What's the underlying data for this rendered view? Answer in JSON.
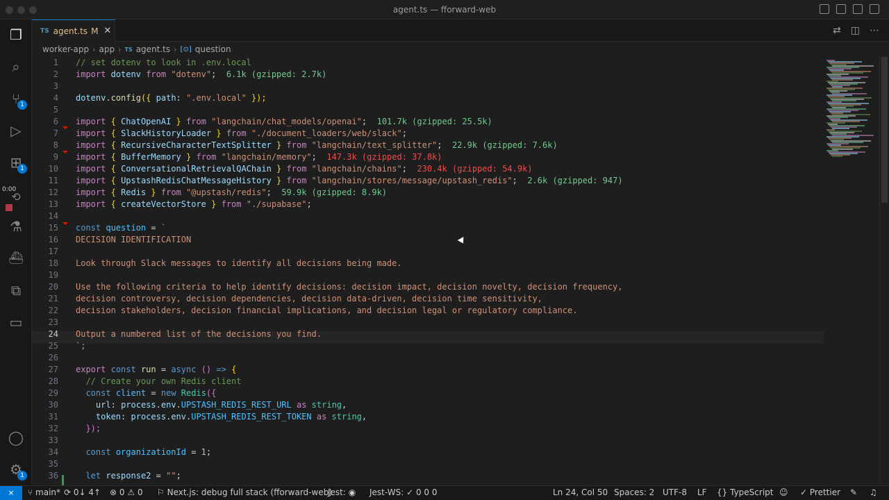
{
  "window": {
    "title": "agent.ts — fforward-web"
  },
  "tab": {
    "type": "TS",
    "name": "agent.ts",
    "modified": "M",
    "close": "✕"
  },
  "breadcrumb": {
    "folder1": "worker-app",
    "folder2": "app",
    "file_type": "TS",
    "file": "agent.ts",
    "symbol_icon": "[⊙]",
    "symbol": "question"
  },
  "activity": {
    "timer": "0:00",
    "scm_badge": "1",
    "ext_badge": "1",
    "account_badge": "1"
  },
  "status": {
    "remote": "⨯",
    "branch": "main*",
    "sync": "0↓ 4↑",
    "problems_errors": "0",
    "problems_warnings": "0",
    "debug": "Next.js: debug full stack (fforward-web)",
    "jest": "Jest:",
    "jestws": "Jest-WS:",
    "jestws_counts": "0  0  0",
    "position": "Ln 24, Col 50",
    "spaces": "Spaces: 2",
    "encoding": "UTF-8",
    "eol": "LF",
    "language": "TypeScript",
    "prettier": "Prettier"
  },
  "code_lines": [
    {
      "n": "1"
    },
    {
      "n": "2"
    },
    {
      "n": "3"
    },
    {
      "n": "4"
    },
    {
      "n": "5"
    },
    {
      "n": "6"
    },
    {
      "n": "7"
    },
    {
      "n": "8"
    },
    {
      "n": "9"
    },
    {
      "n": "10"
    },
    {
      "n": "11"
    },
    {
      "n": "12"
    },
    {
      "n": "13"
    },
    {
      "n": "14"
    },
    {
      "n": "15"
    },
    {
      "n": "16"
    },
    {
      "n": "17"
    },
    {
      "n": "18"
    },
    {
      "n": "19"
    },
    {
      "n": "20"
    },
    {
      "n": "21"
    },
    {
      "n": "22"
    },
    {
      "n": "23"
    },
    {
      "n": "24"
    },
    {
      "n": "25"
    },
    {
      "n": "26"
    },
    {
      "n": "27"
    },
    {
      "n": "28"
    },
    {
      "n": "29"
    },
    {
      "n": "30"
    },
    {
      "n": "31"
    },
    {
      "n": "32"
    },
    {
      "n": "33"
    },
    {
      "n": "34"
    },
    {
      "n": "35"
    },
    {
      "n": "36"
    }
  ],
  "code": {
    "l1": "// set dotenv to look in .env.local",
    "l2a": "import",
    "l2b": "dotenv",
    "l2c": "from",
    "l2d": "\"dotenv\"",
    "l2e": ";",
    "l2f": "6.1k (gzipped: 2.7k)",
    "l4a": "dotenv",
    "l4b": ".",
    "l4c": "config",
    "l4d": "({",
    "l4e": "path",
    "l4f": ":",
    "l4g": "\".env.local\"",
    "l4h": "});",
    "l6a": "import",
    "l6b": "{",
    "l6c": "ChatOpenAI",
    "l6d": "}",
    "l6e": "from",
    "l6f": "\"langchain/chat_models/openai\"",
    "l6g": ";",
    "l6h": "101.7k (gzipped: 25.5k)",
    "l7a": "import",
    "l7b": "{",
    "l7c": "SlackHistoryLoader",
    "l7d": "}",
    "l7e": "from",
    "l7f": "\"./document_loaders/web/slack\"",
    "l7g": ";",
    "l8a": "import",
    "l8b": "{",
    "l8c": "RecursiveCharacterTextSplitter",
    "l8d": "}",
    "l8e": "from",
    "l8f": "\"langchain/text_splitter\"",
    "l8g": ";",
    "l8h": "22.9k (gzipped: 7.6k)",
    "l9a": "import",
    "l9b": "{",
    "l9c": "BufferMemory",
    "l9d": "}",
    "l9e": "from",
    "l9f": "\"langchain/memory\"",
    "l9g": ";",
    "l9h": "147.3k (gzipped: 37.8k)",
    "l10a": "import",
    "l10b": "{",
    "l10c": "ConversationalRetrievalQAChain",
    "l10d": "}",
    "l10e": "from",
    "l10f": "\"langchain/chains\"",
    "l10g": ";",
    "l10h": "230.4k (gzipped: 54.9k)",
    "l11a": "import",
    "l11b": "{",
    "l11c": "UpstashRedisChatMessageHistory",
    "l11d": "}",
    "l11e": "from",
    "l11f": "\"langchain/stores/message/upstash_redis\"",
    "l11g": ";",
    "l11h": "2.6k (gzipped: 947)",
    "l12a": "import",
    "l12b": "{",
    "l12c": "Redis",
    "l12d": "}",
    "l12e": "from",
    "l12f": "\"@upstash/redis\"",
    "l12g": ";",
    "l12h": "59.9k (gzipped: 8.9k)",
    "l13a": "import",
    "l13b": "{",
    "l13c": "createVectorStore",
    "l13d": "}",
    "l13e": "from",
    "l13f": "\"./supabase\"",
    "l13g": ";",
    "l15a": "const",
    "l15b": "question",
    "l15c": "=",
    "l15d": "`",
    "l16": "DECISION IDENTIFICATION",
    "l18": "Look through Slack messages to identify all decisions being made.",
    "l20": "Use the following criteria to help identify decisions: decision impact, decision novelty, decision frequency,",
    "l21": "decision controversy, decision dependencies, decision data-driven, decision time sensitivity,",
    "l22": "decision stakeholders, decision financial implications, and decision legal or regulatory compliance.",
    "l24": "Output a numbered list of the decisions you find.",
    "l25": "`;",
    "l27a": "export",
    "l27b": "const",
    "l27c": "run",
    "l27d": "=",
    "l27e": "async",
    "l27f": "()",
    "l27g": "=>",
    "l27h": "{",
    "l28": "// Create your own Redis client",
    "l29a": "const",
    "l29b": "client",
    "l29c": "=",
    "l29d": "new",
    "l29e": "Redis",
    "l29f": "({",
    "l30a": "url",
    "l30b": ":",
    "l30c": "process",
    "l30d": ".",
    "l30e": "env",
    "l30f": ".",
    "l30g": "UPSTASH_REDIS_REST_URL",
    "l30h": "as",
    "l30i": "string",
    "l30j": ",",
    "l31a": "token",
    "l31b": ":",
    "l31c": "process",
    "l31d": ".",
    "l31e": "env",
    "l31f": ".",
    "l31g": "UPSTASH_REDIS_REST_TOKEN",
    "l31h": "as",
    "l31i": "string",
    "l31j": ",",
    "l32": "});",
    "l34a": "const",
    "l34b": "organizationId",
    "l34c": "=",
    "l34d": "1",
    "l34e": ";",
    "l36a": "let",
    "l36b": "response2",
    "l36c": "=",
    "l36d": "\"\"",
    "l36e": ";"
  },
  "colors": {
    "accent": "#0078d4",
    "modified": "#e2c08d",
    "size_ok": "#73c991",
    "size_warn": "#f14c4c"
  }
}
